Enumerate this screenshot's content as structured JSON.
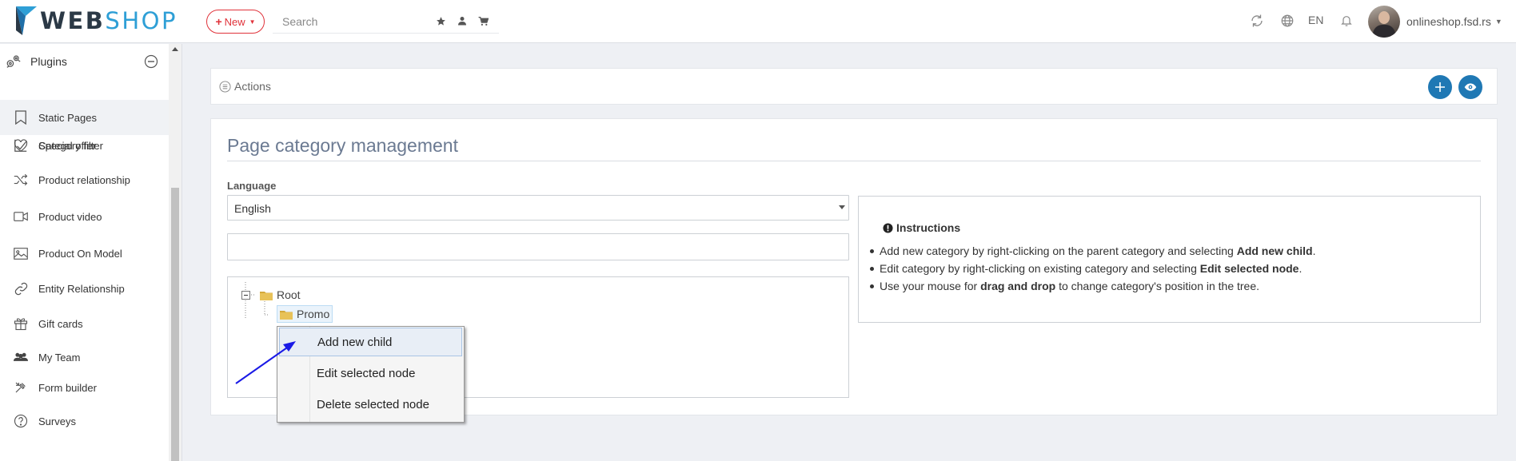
{
  "header": {
    "logo_part1": "WEB",
    "logo_part2": "SHOP",
    "new_button_label": "New",
    "search_placeholder": "Search",
    "language": "EN",
    "user_name": "onlineshop.fsd.rs"
  },
  "sidebar": {
    "section_title": "Plugins",
    "items": [
      {
        "label": "Category filter",
        "icon": "checkbox-chart-icon"
      },
      {
        "label": "Static Pages",
        "icon": "bookmark-icon",
        "active": true
      },
      {
        "label": "Special offer",
        "icon": "heart-icon"
      },
      {
        "label": "Product relationship",
        "icon": "shuffle-icon"
      },
      {
        "label": "Product video",
        "icon": "video-icon"
      },
      {
        "label": "Product On Model",
        "icon": "image-icon"
      },
      {
        "label": "Entity Relationship",
        "icon": "link-icon"
      },
      {
        "label": "Gift cards",
        "icon": "gift-icon"
      },
      {
        "label": "My Team",
        "icon": "users-icon"
      },
      {
        "label": "Form builder",
        "icon": "tools-icon"
      },
      {
        "label": "Surveys",
        "icon": "question-icon"
      }
    ]
  },
  "actions": {
    "label": "Actions"
  },
  "main": {
    "title": "Page category management",
    "language_label": "Language",
    "language_value": "English",
    "tree": {
      "root": "Root",
      "child": "Promo"
    },
    "instructions": {
      "title": "Instructions",
      "items": [
        {
          "pre": "Add new category by right-clicking on the parent category and selecting ",
          "bold": "Add new child",
          "post": "."
        },
        {
          "pre": "Edit category by right-clicking on existing category and selecting ",
          "bold": "Edit selected node",
          "post": "."
        },
        {
          "pre": "Use your mouse for ",
          "bold": "drag and drop",
          "post": " to change category's position in the tree."
        }
      ]
    }
  },
  "context_menu": {
    "items": [
      "Add new child",
      "Edit selected node",
      "Delete selected node"
    ]
  },
  "colors": {
    "brand_dark": "#2b3946",
    "brand_blue": "#2e9fd6",
    "accent_red": "#e0323a",
    "action_blue": "#1f78b4",
    "title_gray": "#6b7a92"
  }
}
